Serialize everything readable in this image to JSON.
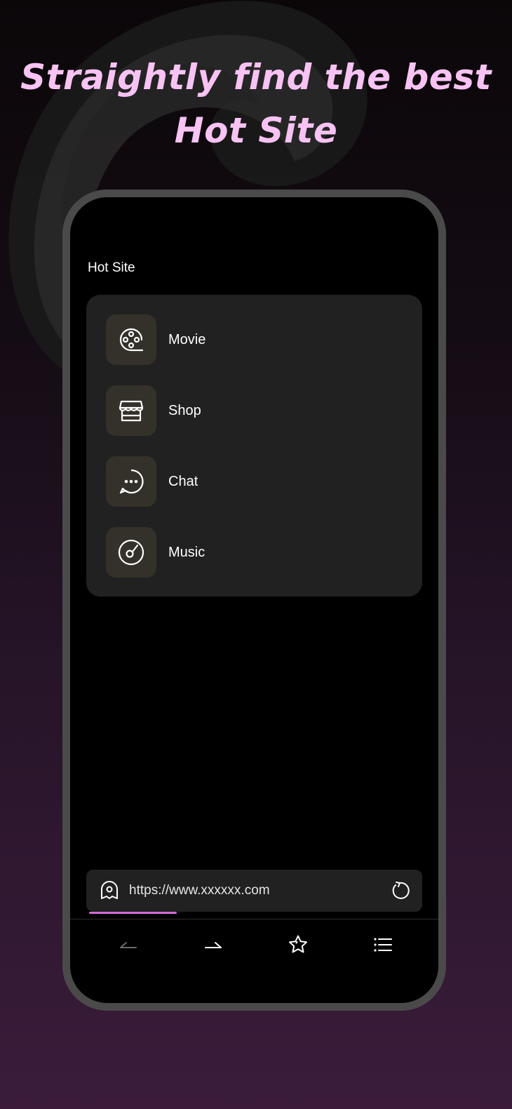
{
  "promo": {
    "headline_line1": "Straightly find the best",
    "headline_line2": "Hot Site"
  },
  "hot_site": {
    "title": "Hot Site",
    "items": [
      {
        "label": "Movie",
        "icon": "film-reel-icon"
      },
      {
        "label": "Shop",
        "icon": "storefront-icon"
      },
      {
        "label": "Chat",
        "icon": "chat-bubble-icon"
      },
      {
        "label": "Music",
        "icon": "music-disc-icon"
      }
    ]
  },
  "address_bar": {
    "url": "https://www.xxxxxx.com",
    "left_icon": "ghost-icon",
    "right_icon": "reload-icon",
    "load_progress": 0.26
  },
  "bottom_nav": {
    "items": [
      {
        "icon": "back-arrow-icon",
        "enabled": false
      },
      {
        "icon": "forward-arrow-icon",
        "enabled": true
      },
      {
        "icon": "star-icon",
        "enabled": true
      },
      {
        "icon": "menu-icon",
        "enabled": true
      }
    ]
  },
  "colors": {
    "headline": "#f7c3f3",
    "progress": "#d56ad9",
    "card": "#212121",
    "icon_tile": "#34312a"
  }
}
